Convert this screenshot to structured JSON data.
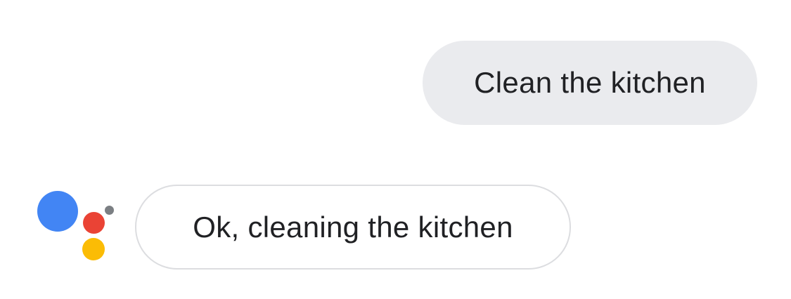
{
  "conversation": {
    "user_message": "Clean the kitchen",
    "assistant_message": "Ok, cleaning the kitchen"
  },
  "colors": {
    "user_bubble_bg": "#eaebee",
    "assistant_bubble_border": "#dcdde0",
    "logo_blue": "#4285f4",
    "logo_red": "#ea4335",
    "logo_yellow": "#fbbc05",
    "logo_gray": "#7b7f83"
  },
  "icons": {
    "assistant_logo": "google-assistant-icon"
  }
}
